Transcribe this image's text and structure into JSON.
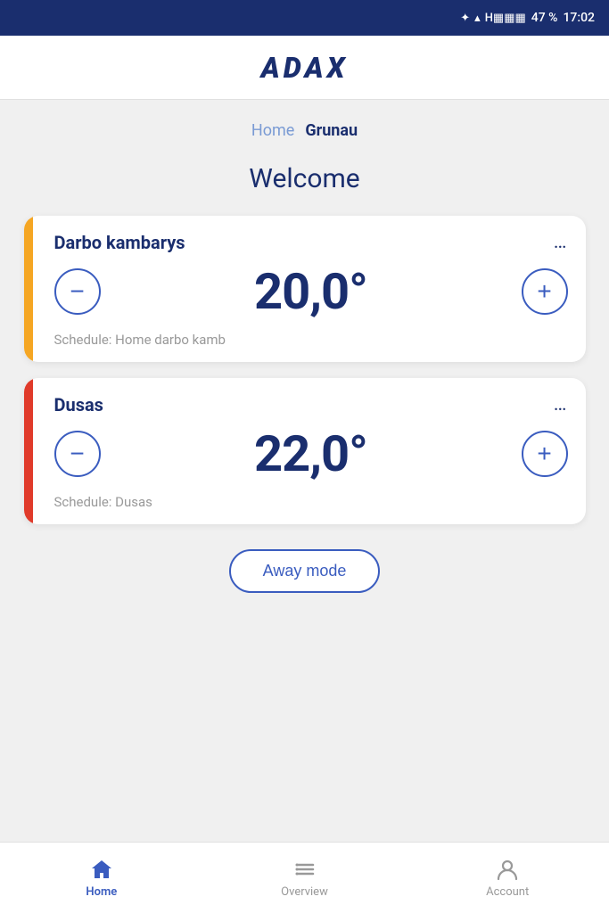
{
  "statusBar": {
    "battery": "47 %",
    "time": "17:02"
  },
  "header": {
    "logo": "ADAX"
  },
  "breadcrumb": {
    "items": [
      {
        "label": "Home",
        "active": false
      },
      {
        "label": "Grunau",
        "active": true
      }
    ]
  },
  "welcome": {
    "title": "Welcome"
  },
  "rooms": [
    {
      "name": "Darbo kambarys",
      "temperature": "20,0°",
      "schedule": "Schedule: Home darbo kamb",
      "indicatorClass": "indicator-yellow",
      "decrementLabel": "−",
      "incrementLabel": "+"
    },
    {
      "name": "Dusas",
      "temperature": "22,0°",
      "schedule": "Schedule: Dusas",
      "indicatorClass": "indicator-orange",
      "decrementLabel": "−",
      "incrementLabel": "+"
    }
  ],
  "awayModeButton": {
    "label": "Away mode"
  },
  "bottomNav": {
    "items": [
      {
        "label": "Home",
        "icon": "home-icon",
        "active": true
      },
      {
        "label": "Overview",
        "icon": "overview-icon",
        "active": false
      },
      {
        "label": "Account",
        "icon": "account-icon",
        "active": false
      }
    ]
  }
}
